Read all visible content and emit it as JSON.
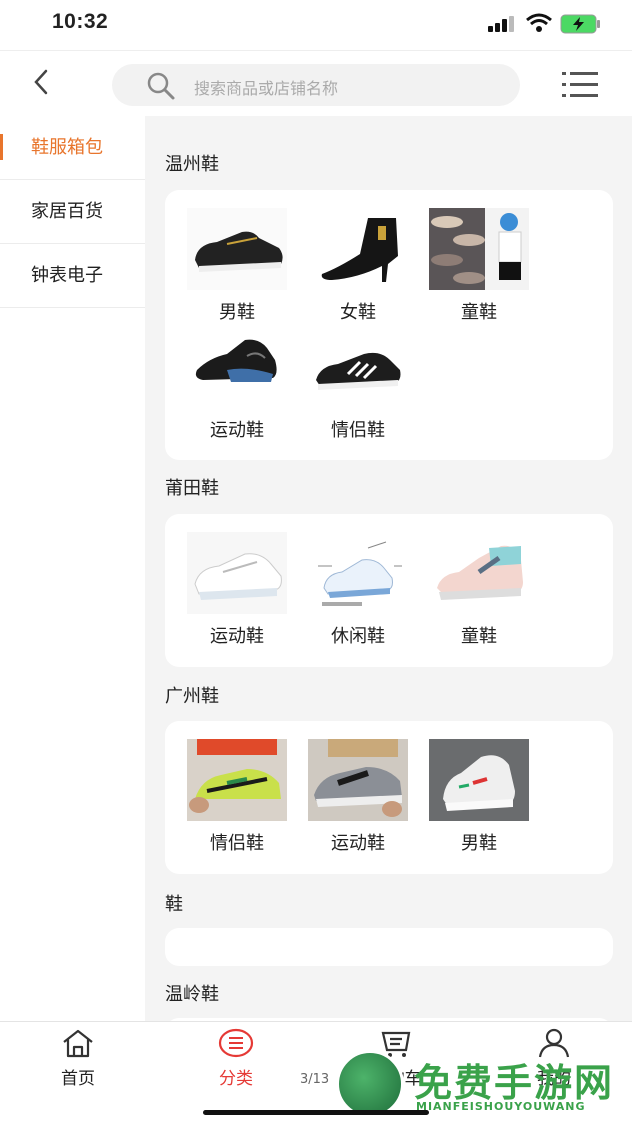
{
  "status_bar": {
    "time": "10:32"
  },
  "search": {
    "placeholder": "搜索商品或店铺名称"
  },
  "sidebar": {
    "items": [
      {
        "label": "鞋服箱包",
        "active": true
      },
      {
        "label": "家居百货",
        "active": false
      },
      {
        "label": "钟表电子",
        "active": false
      }
    ]
  },
  "sections": [
    {
      "title": "温州鞋",
      "items": [
        {
          "label": "男鞋",
          "icon": "mens-shoe-image"
        },
        {
          "label": "女鞋",
          "icon": "womens-boot-image"
        },
        {
          "label": "童鞋",
          "icon": "kids-shoe-image"
        },
        {
          "label": "运动鞋",
          "icon": "sport-shoe-image"
        },
        {
          "label": "情侣鞋",
          "icon": "couple-shoe-image"
        }
      ]
    },
    {
      "title": "莆田鞋",
      "items": [
        {
          "label": "运动鞋",
          "icon": "white-sneaker-image"
        },
        {
          "label": "休闲鞋",
          "icon": "casual-shoe-image"
        },
        {
          "label": "童鞋",
          "icon": "kids-sneaker-image"
        }
      ]
    },
    {
      "title": "广州鞋",
      "items": [
        {
          "label": "情侣鞋",
          "icon": "couple-sneaker-image"
        },
        {
          "label": "运动鞋",
          "icon": "running-shoe-image"
        },
        {
          "label": "男鞋",
          "icon": "mens-sneaker-image"
        }
      ]
    },
    {
      "title": "鞋",
      "items": []
    },
    {
      "title": "温岭鞋",
      "items": []
    }
  ],
  "tabbar": {
    "items": [
      {
        "label": "首页",
        "icon": "home-icon"
      },
      {
        "label": "分类",
        "icon": "category-icon",
        "active": true
      },
      {
        "label": "购物车",
        "icon": "cart-icon"
      },
      {
        "label": "我的",
        "icon": "user-icon"
      }
    ]
  },
  "watermark": {
    "title": "免费手游网",
    "subtitle": "MIANFEISHOUYOUWANG",
    "page": "3/13"
  },
  "colors": {
    "accent": "#e8752c",
    "tab_active": "#e53935",
    "content_bg": "#f4f4f4"
  }
}
